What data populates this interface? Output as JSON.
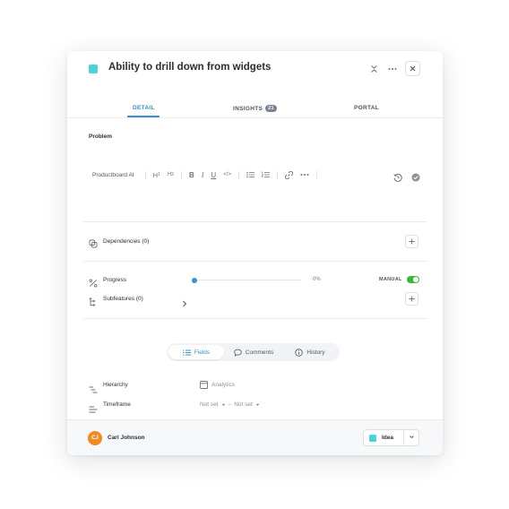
{
  "header": {
    "title": "Ability to drill down from widgets",
    "accent_color": "#4fd1d9"
  },
  "tabs": [
    {
      "label": "DETAIL",
      "active": true
    },
    {
      "label": "INSIGHTS",
      "count": "21"
    },
    {
      "label": "PORTAL"
    }
  ],
  "description": {
    "section_label": "Problem",
    "toolbar": {
      "ai_label": "Productboard AI",
      "items": [
        "H1",
        "H2",
        "B",
        "I",
        "U",
        "</>"
      ]
    }
  },
  "dependencies": {
    "label": "Dependencies (0)"
  },
  "progress": {
    "label": "Progress",
    "value": 0,
    "value_text": "0%",
    "mode_label": "MANUAL",
    "manual_on": true
  },
  "subfeatures": {
    "label": "Subfeatures (0)"
  },
  "view_switch": [
    {
      "label": "Fields",
      "icon": "list-icon",
      "active": true
    },
    {
      "label": "Comments",
      "icon": "comment-icon"
    },
    {
      "label": "History",
      "icon": "info-icon"
    }
  ],
  "fields": {
    "hierarchy": {
      "label": "Hierarchy",
      "value": "Analytics"
    },
    "timeframe": {
      "label": "Timeframe",
      "start": "Not set",
      "end": "Not set"
    }
  },
  "footer": {
    "owner_initials": "CJ",
    "owner_name": "Carl Johnson",
    "status": "Idea",
    "status_color": "#4fd1d9"
  }
}
